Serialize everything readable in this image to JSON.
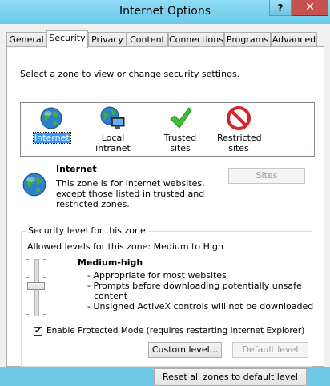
{
  "window": {
    "title": "Internet Options",
    "help_glyph": "?",
    "close_glyph": "✕"
  },
  "tabs": [
    "General",
    "Security",
    "Privacy",
    "Content",
    "Connections",
    "Programs",
    "Advanced"
  ],
  "active_tab": "Security",
  "security": {
    "zone_prompt": "Select a zone to view or change security settings.",
    "zones": [
      {
        "label": "Internet",
        "icon": "globe-icon",
        "selected": true
      },
      {
        "label": "Local intranet",
        "icon": "intranet-icon",
        "selected": false
      },
      {
        "label": "Trusted sites",
        "icon": "checkmark-icon",
        "selected": false
      },
      {
        "label": "Restricted sites",
        "label_line1": "Restricted",
        "label_line2": "sites",
        "icon": "no-entry-icon",
        "selected": false
      }
    ],
    "selected_zone": {
      "name": "Internet",
      "description_lines": [
        "This zone is for Internet websites,",
        "except those listed in trusted and",
        "restricted zones."
      ],
      "sites_button": "Sites",
      "sites_enabled": false
    },
    "level_group": {
      "title": "Security level for this zone",
      "allowed": "Allowed levels for this zone: Medium to High",
      "level_name": "Medium-high",
      "bullets": [
        "- Appropriate for most websites",
        "- Prompts before downloading potentially unsafe",
        "content",
        "- Unsigned ActiveX controls will not be downloaded"
      ],
      "slider_level": "Medium-high",
      "protected_mode_label": "Enable Protected Mode (requires restarting Internet Explorer)",
      "protected_mode_checked": true,
      "custom_level_button": "Custom level...",
      "default_level_button": "Default level",
      "default_level_enabled": false
    },
    "reset_all_button": "Reset all zones to default level"
  },
  "colors": {
    "selection": "#3399ff",
    "close": "#c75050",
    "titlebar": "#6fc8e6"
  }
}
